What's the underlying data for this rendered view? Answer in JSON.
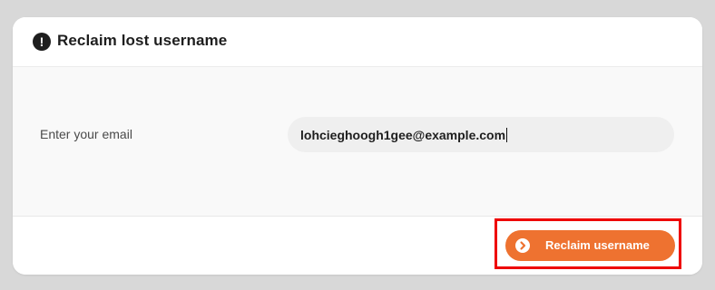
{
  "dialog": {
    "title": "Reclaim lost username",
    "title_icon": "exclamation-circle-icon"
  },
  "form": {
    "email_label": "Enter your email",
    "email_value": "lohcieghoogh1gee@example.com"
  },
  "footer": {
    "submit_label": "Reclaim username",
    "submit_icon": "chevron-right-circle-icon",
    "submit_color": "#ee7230",
    "highlight_color": "#ee0000"
  }
}
